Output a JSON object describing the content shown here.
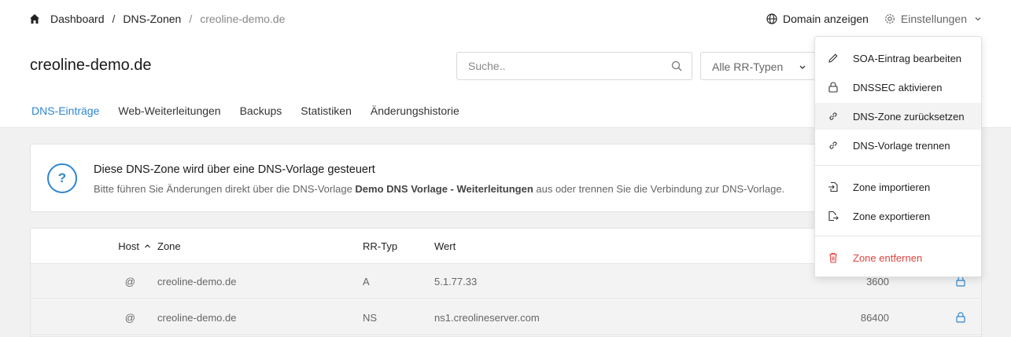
{
  "breadcrumb": {
    "items": [
      "Dashboard",
      "DNS-Zonen",
      "creoline-demo.de"
    ],
    "separator": "/"
  },
  "top_actions": {
    "show_domain": "Domain anzeigen",
    "settings": "Einstellungen"
  },
  "page_title": "creoline-demo.de",
  "search": {
    "placeholder": "Suche.."
  },
  "rr_filter": {
    "selected": "Alle RR-Typen"
  },
  "tabs": [
    {
      "label": "DNS-Einträge",
      "active": true
    },
    {
      "label": "Web-Weiterleitungen",
      "active": false
    },
    {
      "label": "Backups",
      "active": false
    },
    {
      "label": "Statistiken",
      "active": false
    },
    {
      "label": "Änderungshistorie",
      "active": false
    }
  ],
  "notice": {
    "title": "Diese DNS-Zone wird über eine DNS-Vorlage gesteuert",
    "text_before": "Bitte führen Sie Änderungen direkt über die DNS-Vorlage ",
    "template_name": "Demo DNS Vorlage - Weiterleitungen",
    "text_after": " aus oder trennen Sie die Verbindung zur DNS-Vorlage.",
    "icon": "?"
  },
  "table": {
    "headers": {
      "host": "Host",
      "zone": "Zone",
      "type": "RR-Typ",
      "value": "Wert"
    },
    "rows": [
      {
        "host": "@",
        "zone": "creoline-demo.de",
        "type": "A",
        "value": "5.1.77.33",
        "ttl": "3600"
      },
      {
        "host": "@",
        "zone": "creoline-demo.de",
        "type": "NS",
        "value": "ns1.creolineserver.com",
        "ttl": "86400"
      }
    ]
  },
  "settings_menu": {
    "items": [
      {
        "label": "SOA-Eintrag bearbeiten",
        "icon": "pencil-icon"
      },
      {
        "label": "DNSSEC aktivieren",
        "icon": "lock-icon"
      },
      {
        "label": "DNS-Zone zurücksetzen",
        "icon": "link-icon"
      },
      {
        "label": "DNS-Vorlage trennen",
        "icon": "link-icon"
      },
      {
        "label": "Zone importieren",
        "icon": "file-import-icon"
      },
      {
        "label": "Zone exportieren",
        "icon": "file-export-icon"
      },
      {
        "label": "Zone entfernen",
        "icon": "trash-icon"
      }
    ]
  },
  "colors": {
    "accent": "#2f86cf",
    "danger": "#e0443e",
    "content_bg": "#f1f1f1"
  }
}
